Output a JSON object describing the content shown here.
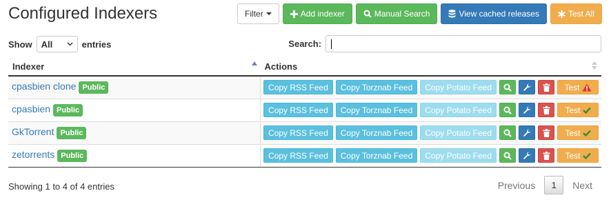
{
  "header": {
    "title": "Configured Indexers",
    "filter_label": "Filter",
    "add_label": "Add indexer",
    "manual_search_label": "Manual Search",
    "cached_label": "View cached releases",
    "test_all_label": "Test All"
  },
  "controls": {
    "show_label": "Show",
    "entries_select_value": "All",
    "entries_label": "entries",
    "search_label": "Search:",
    "search_value": ""
  },
  "table": {
    "columns": [
      "Indexer",
      "Actions"
    ],
    "rows": [
      {
        "name": "cpasbien clone",
        "badge": "Public",
        "rss": "Copy RSS Feed",
        "torznab": "Copy Torznab Feed",
        "potato": "Copy Potato Feed",
        "test": "Test",
        "status": "warning"
      },
      {
        "name": "cpasbien",
        "badge": "Public",
        "rss": "Copy RSS Feed",
        "torznab": "Copy Torznab Feed",
        "potato": "Copy Potato Feed",
        "test": "Test",
        "status": "ok"
      },
      {
        "name": "GkTorrent",
        "badge": "Public",
        "rss": "Copy RSS Feed",
        "torznab": "Copy Torznab Feed",
        "potato": "Copy Potato Feed",
        "test": "Test",
        "status": "ok"
      },
      {
        "name": "zetorrents",
        "badge": "Public",
        "rss": "Copy RSS Feed",
        "torznab": "Copy Torznab Feed",
        "potato": "Copy Potato Feed",
        "test": "Test",
        "status": "ok"
      }
    ]
  },
  "footer": {
    "info": "Showing 1 to 4 of 4 entries",
    "previous": "Previous",
    "current_page": "1",
    "next": "Next"
  },
  "colors": {
    "success": "#5cb85c",
    "primary": "#337ab7",
    "warning": "#f0ad4e",
    "info": "#5bc0de",
    "danger": "#d9534f"
  }
}
